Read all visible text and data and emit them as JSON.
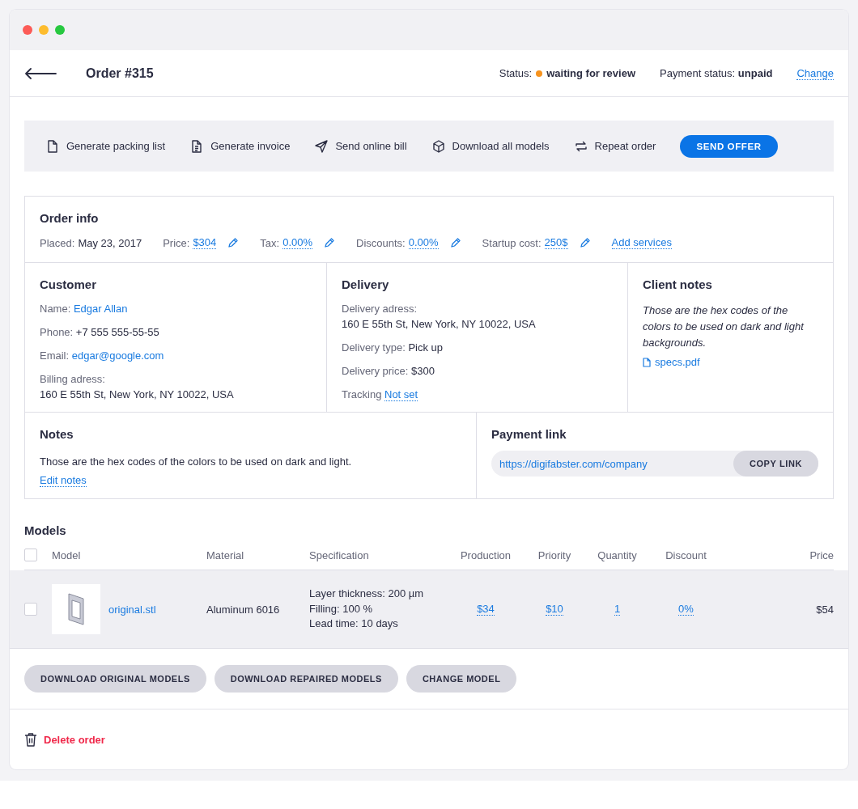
{
  "header": {
    "title": "Order #315",
    "status_label": "Status:",
    "status": "waiting for review",
    "payment_label": "Payment status:",
    "payment": "unpaid",
    "change": "Change"
  },
  "actions": [
    {
      "kind": "page",
      "label": "Generate packing list"
    },
    {
      "kind": "doc",
      "label": "Generate invoice"
    },
    {
      "kind": "send",
      "label": "Send online bill"
    },
    {
      "kind": "box",
      "label": "Download all models"
    },
    {
      "kind": "repeat",
      "label": "Repeat order"
    },
    {
      "kind": "primary",
      "label": "SEND OFFER"
    }
  ],
  "order_info": {
    "title": "Order info",
    "fields": [
      {
        "label": "Placed:",
        "value": "May 23, 2017",
        "editable": false,
        "kind": "none"
      },
      {
        "label": "Price:",
        "value": "$304",
        "editable": true,
        "kind": "dotted"
      },
      {
        "label": "Tax:",
        "value": "0.00%",
        "editable": true,
        "kind": "dotted"
      },
      {
        "label": "Discounts:",
        "value": "0.00%",
        "editable": true,
        "kind": "dotted"
      },
      {
        "label": "Startup cost:",
        "value": "250$",
        "editable": true,
        "kind": "dotted"
      }
    ],
    "add": "Add services"
  },
  "customer": {
    "title": "Customer",
    "fields": [
      {
        "label": "Name:",
        "value": "Edgar Allan",
        "kind": "plain",
        "block": false
      },
      {
        "label": "Phone:",
        "value": "+7 555 555-55-55",
        "kind": "none",
        "block": false
      },
      {
        "label": "Email:",
        "value": "edgar@google.com",
        "kind": "plain",
        "block": false
      },
      {
        "label": "Billing adress:",
        "value": "160 E 55th St, New York, NY 10022, USA",
        "kind": "none",
        "block": true
      }
    ]
  },
  "delivery": {
    "title": "Delivery",
    "fields": [
      {
        "label": "Delivery adress:",
        "value": "160 E 55th St, New York, NY 10022, USA",
        "kind": "none",
        "block": true
      },
      {
        "label": "Delivery type:",
        "value": "Pick up",
        "kind": "none",
        "block": false
      },
      {
        "label": "Delivery price:",
        "value": "$300",
        "kind": "none",
        "block": false
      },
      {
        "label": "Tracking",
        "value": "Not set",
        "kind": "dotted",
        "block": false
      }
    ]
  },
  "client_notes": {
    "title": "Client notes",
    "text": "Those are the hex codes of the colors to be used on dark and light backgrounds.",
    "file": "specs.pdf"
  },
  "notes": {
    "title": "Notes",
    "text": "Those are the hex codes of the colors to be used on dark and light.",
    "edit": "Edit notes"
  },
  "payment_link": {
    "title": "Payment link",
    "url": "https://digifabster.com/company",
    "button": "COPY LINK"
  },
  "models": {
    "title": "Models",
    "select_all_checked": false,
    "columns": [
      "Model",
      "Material",
      "Specification",
      "Production",
      "Priority",
      "Quantity",
      "Discount",
      "Price"
    ],
    "rows": [
      {
        "checked": false,
        "file": "original.stl",
        "material": "Aluminum 6016",
        "spec": [
          "Layer thickness: 200 µm",
          "Filling: 100 %",
          "Lead time: 10 days"
        ],
        "production": "$34",
        "priority": "$10",
        "quantity": "1",
        "discount": "0%",
        "price": "$54"
      }
    ],
    "buttons": [
      "DOWNLOAD ORIGINAL MODELS",
      "DOWNLOAD REPAIRED MODELS",
      "CHANGE MODEL"
    ]
  },
  "delete": "Delete order"
}
